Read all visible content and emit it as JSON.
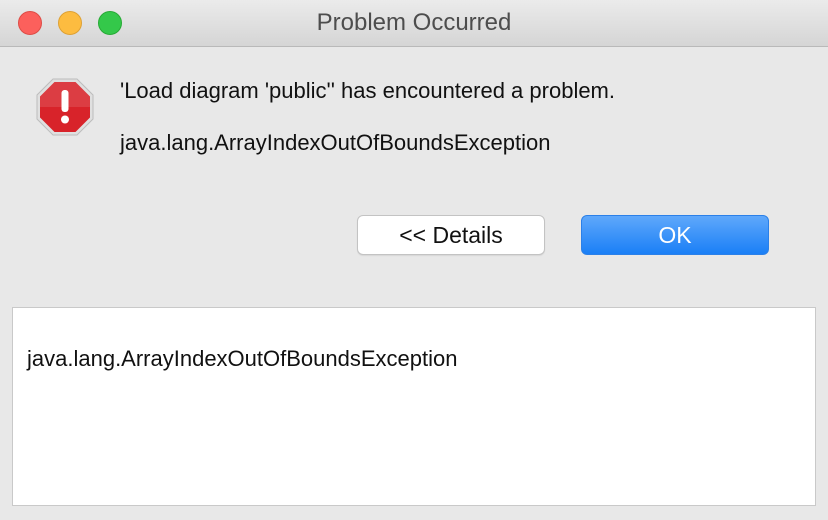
{
  "window": {
    "title": "Problem Occurred"
  },
  "message": {
    "text": "'Load diagram 'public'' has encountered a problem.",
    "exception": "java.lang.ArrayIndexOutOfBoundsException"
  },
  "buttons": {
    "details_label": "<< Details",
    "ok_label": "OK"
  },
  "details": {
    "text": "java.lang.ArrayIndexOutOfBoundsException"
  },
  "icons": {
    "window_controls": [
      "close-icon",
      "minimize-icon",
      "maximize-icon"
    ],
    "alert": "error-stop-icon"
  },
  "colors": {
    "close": "#fc605c",
    "minimize": "#fdbc40",
    "maximize": "#34c84a",
    "error_icon": "#d8232a",
    "ok_button": "#1a7ff6"
  }
}
